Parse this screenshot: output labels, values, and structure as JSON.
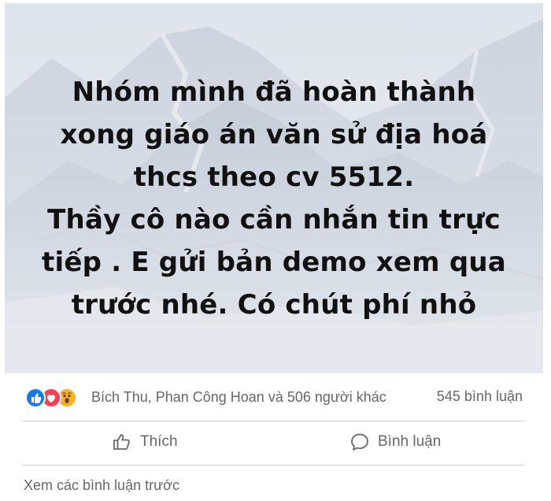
{
  "post": {
    "lines": [
      "Nhóm mình đã hoàn thành",
      "xong giáo án văn sử địa hoá",
      "thcs theo cv 5512.",
      "Thầy cô nào cần nhắn tin trực",
      "tiếp . E gửi bản demo xem qua",
      "trước nhé. Có chút phí nhỏ"
    ]
  },
  "stats": {
    "reactions": [
      "like-icon",
      "love-icon",
      "wow-icon"
    ],
    "reactors": "Bích Thu, Phan Công Hoan và 506 người khác",
    "comment_count": "545 bình luận"
  },
  "actions": {
    "like_label": "Thích",
    "comment_label": "Bình luận"
  },
  "comments": {
    "view_previous": "Xem các bình luận trước"
  },
  "colors": {
    "like_blue": "#1877f2",
    "love_red": "#f33e58",
    "wow_yellow": "#f7b125",
    "secondary_text": "#65676b"
  }
}
